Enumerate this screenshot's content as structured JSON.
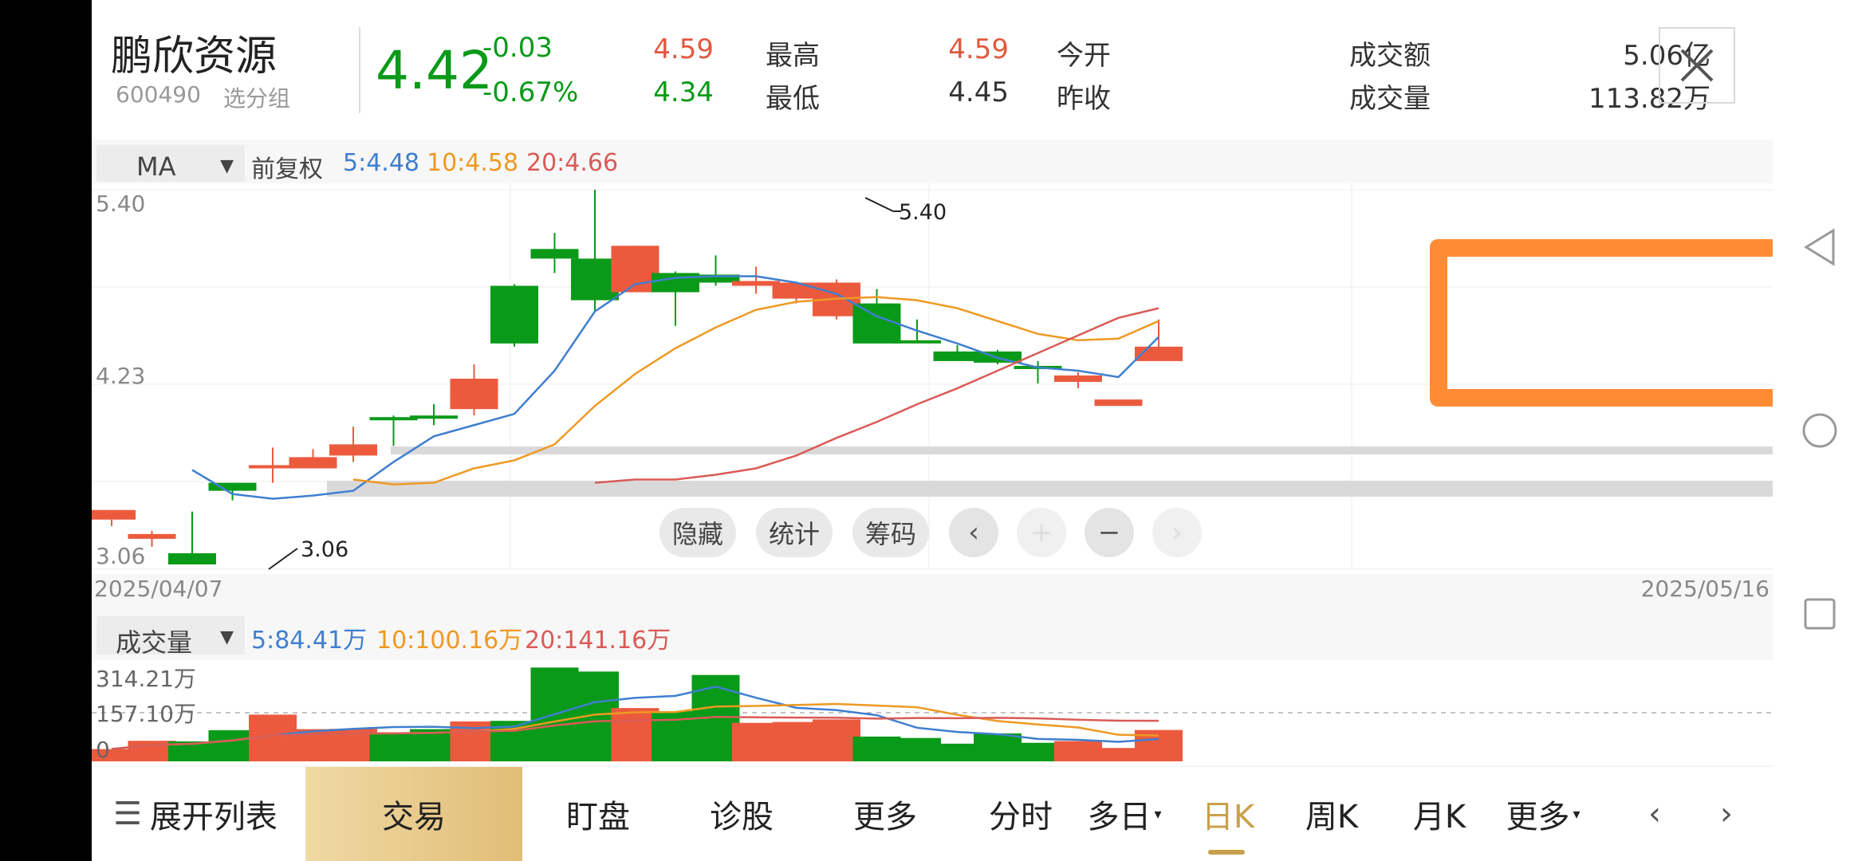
{
  "stock": {
    "name": "鹏欣资源",
    "code": "600490",
    "group_btn": "选分组",
    "price": "4.42",
    "change": "-0.03",
    "change_pct": "-0.67%"
  },
  "quotes": {
    "high_label": "最高",
    "high": "4.59",
    "low_label": "最低",
    "low": "4.34",
    "open_label": "今开",
    "open": "4.59",
    "prev_label": "昨收",
    "prev": "4.45",
    "amount_label": "成交额",
    "amount": "5.06亿",
    "volume_label": "成交量",
    "volume": "113.82万"
  },
  "colors": {
    "up": "#ec5a3e",
    "down": "#0a9a19",
    "ma5": "#3f7fd0",
    "ma10": "#ee9922",
    "ma20": "#d95b57",
    "highlight": "#ff8c35"
  },
  "indicator": {
    "selector": "MA",
    "adjust": "前复权",
    "ma5": "5:4.48",
    "ma10": "10:4.58",
    "ma20": "20:4.66"
  },
  "axis": {
    "y_top": "5.40",
    "y_mid": "4.23",
    "y_bottom": "3.06",
    "date_start": "2025/04/07",
    "date_end": "2025/05/16",
    "high_mark": "5.40",
    "low_mark": "3.06"
  },
  "tools": {
    "hide": "隐藏",
    "stats": "统计",
    "chips": "筹码"
  },
  "volume_panel": {
    "selector": "成交量",
    "ma5": "5:84.41万",
    "ma10": "10:100.16万",
    "ma20": "20:141.16万",
    "y_top": "314.21万",
    "y_mid": "157.10万",
    "y_zero": "0"
  },
  "bottom_bar": {
    "expand": "展开列表",
    "trade": "交易",
    "watch": "盯盘",
    "diagnose": "诊股",
    "more1": "更多",
    "intraday": "分时",
    "multiday": "多日",
    "daily": "日K",
    "weekly": "周K",
    "monthly": "月K",
    "more2": "更多"
  },
  "chart_data": {
    "type": "candlestick",
    "x": [
      "c1",
      "c2",
      "c3",
      "c4",
      "c5",
      "c6",
      "c7",
      "c8",
      "c9",
      "c10",
      "c11",
      "c12",
      "c13",
      "c14",
      "c15",
      "c16",
      "c17",
      "c18",
      "c19",
      "c20",
      "c21",
      "c22",
      "c23",
      "c24",
      "c25",
      "c26",
      "c27"
    ],
    "candles": [
      [
        3.34,
        3.4,
        3.34,
        3.3
      ],
      [
        3.22,
        3.25,
        3.27,
        3.17
      ],
      [
        3.13,
        3.06,
        3.39,
        3.06
      ],
      [
        3.57,
        3.52,
        3.57,
        3.46
      ],
      [
        3.68,
        3.68,
        3.79,
        3.57
      ],
      [
        3.66,
        3.73,
        3.78,
        3.66
      ],
      [
        3.74,
        3.81,
        3.92,
        3.7
      ],
      [
        3.98,
        3.97,
        3.99,
        3.8
      ],
      [
        3.99,
        3.97,
        4.06,
        3.93
      ],
      [
        4.03,
        4.22,
        4.31,
        3.99
      ],
      [
        4.8,
        4.44,
        4.81,
        4.42
      ],
      [
        5.03,
        4.97,
        5.13,
        4.88
      ],
      [
        4.97,
        4.71,
        5.4,
        4.64
      ],
      [
        4.76,
        5.05,
        5.05,
        4.78
      ],
      [
        4.88,
        4.76,
        4.89,
        4.55
      ],
      [
        4.87,
        4.82,
        4.99,
        4.8
      ],
      [
        4.8,
        4.83,
        4.92,
        4.75
      ],
      [
        4.72,
        4.82,
        4.82,
        4.69
      ],
      [
        4.61,
        4.82,
        4.84,
        4.59
      ],
      [
        4.69,
        4.44,
        4.78,
        4.47
      ],
      [
        4.46,
        4.45,
        4.59,
        4.45
      ],
      [
        4.39,
        4.33,
        4.43,
        4.33
      ],
      [
        4.39,
        4.32,
        4.4,
        4.31
      ],
      [
        4.3,
        4.28,
        4.33,
        4.19
      ],
      [
        4.2,
        4.24,
        4.26,
        4.16
      ],
      [
        4.05,
        4.09,
        4.09,
        4.06
      ],
      [
        4.33,
        4.42,
        4.59,
        4.34
      ]
    ],
    "ma5": [
      3.65,
      3.5,
      3.47,
      3.49,
      3.52,
      3.7,
      3.86,
      3.93,
      4.0,
      4.27,
      4.64,
      4.81,
      4.85,
      4.86,
      4.86,
      4.82,
      4.75,
      4.61,
      4.52,
      4.44,
      4.35,
      4.29,
      4.27,
      4.23,
      4.48
    ],
    "ma10": [
      3.59,
      3.56,
      3.57,
      3.66,
      3.71,
      3.81,
      4.05,
      4.25,
      4.41,
      4.54,
      4.65,
      4.7,
      4.72,
      4.73,
      4.71,
      4.66,
      4.58,
      4.5,
      4.46,
      4.47,
      4.58
    ],
    "ma20": [
      3.57,
      3.59,
      3.59,
      3.62,
      3.66,
      3.74,
      3.85,
      3.95,
      4.06,
      4.16,
      4.27,
      4.38,
      4.49,
      4.6,
      4.66
    ],
    "volume": [
      43,
      72,
      70,
      109,
      164,
      113,
      114,
      102,
      113,
      140,
      142,
      329,
      315,
      187,
      176,
      303,
      135,
      138,
      147,
      87,
      82,
      62,
      98,
      65,
      71,
      47,
      110
    ],
    "ylim": [
      3.06,
      5.4
    ]
  }
}
